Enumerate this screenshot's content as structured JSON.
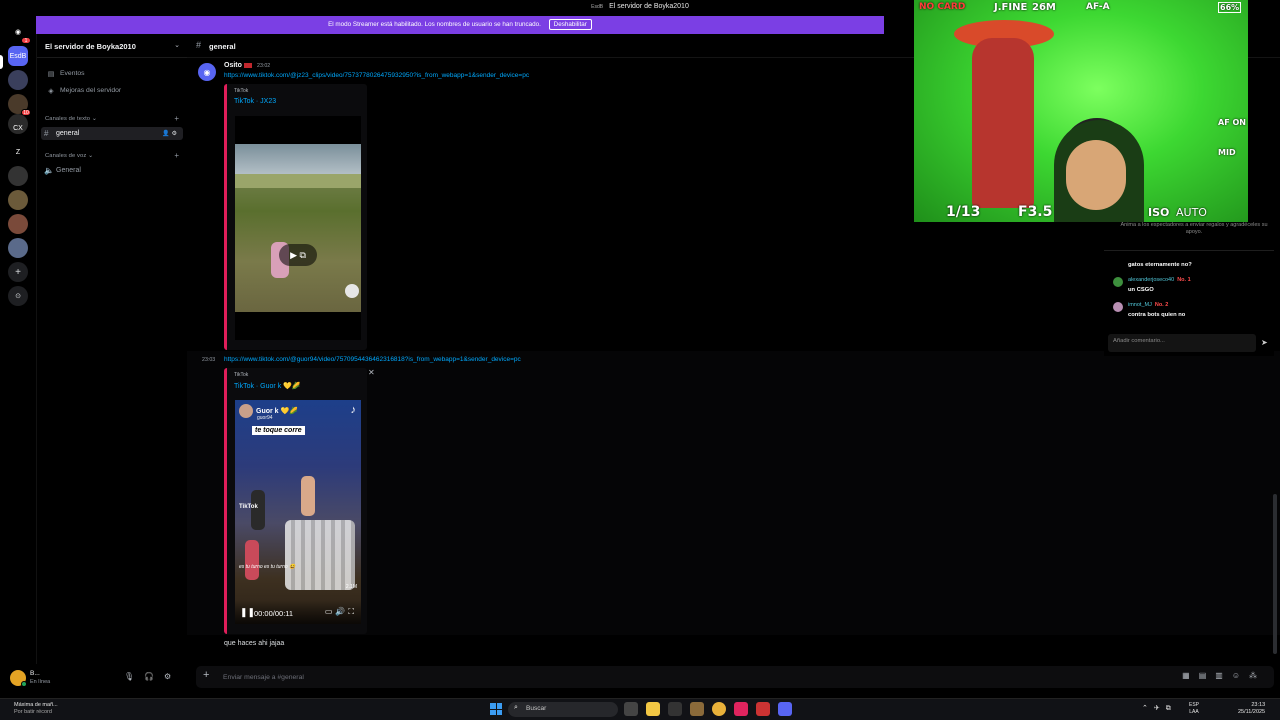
{
  "window": {
    "title": "El servidor de Boyka2010"
  },
  "banner": {
    "text": "El modo Streamer está habilitado. Los nombres de usuario se han truncado.",
    "button": "Deshabilitar"
  },
  "rail": {
    "items": [
      {
        "label": "",
        "icon": "discord-icon",
        "badge": "1"
      },
      {
        "label": "EsdB",
        "icon": "server-icon",
        "badge": ""
      },
      {
        "label": "",
        "icon": "server-icon",
        "badge": ""
      },
      {
        "label": "",
        "icon": "server-icon",
        "badge": "10"
      },
      {
        "label": "",
        "icon": "server-icon",
        "badge": ""
      },
      {
        "label": "CX",
        "icon": "server-icon",
        "badge": ""
      },
      {
        "label": "Z",
        "icon": "server-icon",
        "badge": ""
      },
      {
        "label": "",
        "icon": "server-icon",
        "badge": ""
      },
      {
        "label": "",
        "icon": "server-icon",
        "badge": ""
      },
      {
        "label": "",
        "icon": "server-icon",
        "badge": ""
      },
      {
        "label": "",
        "icon": "server-icon",
        "badge": ""
      },
      {
        "label": "+",
        "icon": "add-server-icon",
        "badge": ""
      },
      {
        "label": "",
        "icon": "compass-icon",
        "badge": ""
      }
    ]
  },
  "sidebar": {
    "server_name": "El servidor de Boyka2010",
    "nav": [
      {
        "label": "Eventos",
        "icon": "calendar-icon"
      },
      {
        "label": "Mejoras del servidor",
        "icon": "boost-icon"
      }
    ],
    "text_category": "Canales de texto",
    "text_channels": [
      {
        "label": "general",
        "active": true
      }
    ],
    "voice_category": "Canales de voz",
    "voice_channels": [
      {
        "label": "General"
      }
    ]
  },
  "user": {
    "name": "B...",
    "status": "En línea"
  },
  "channel": {
    "name": "general"
  },
  "messages": [
    {
      "author": "Osito",
      "time": "23:02",
      "link": "https://www.tiktok.com/@jz23_clips/video/7573778026475932950?is_from_webapp=1&sender_device=pc",
      "embed": {
        "provider": "TikTok",
        "title": "TikTok · JX23"
      }
    },
    {
      "time": "23:03",
      "link": "https://www.tiktok.com/@guor94/video/7570954436462316818?is_from_webapp=1&sender_device=pc",
      "embed": {
        "provider": "TikTok",
        "title": "TikTok · Guor k 💛🌽",
        "video": {
          "creator": "Guor k 💛🌽",
          "handle": "guor94",
          "caption": "te toque corre",
          "watermark": "TikTok",
          "subtitle": "es tu turno es tu turno 😆",
          "time": "00:00/00:11",
          "likes": "2.1M"
        }
      }
    },
    {
      "text": "que haces ahi jajaa"
    }
  ],
  "composer": {
    "placeholder": "Enviar mensaje a #general"
  },
  "camera": {
    "no_card": "NO CARD",
    "focus": "J.FINE",
    "megapixels": "26M",
    "af_mode": "AF-A",
    "battery": "66%",
    "shutter": "1/13",
    "aperture": "F3.5",
    "iso_label": "ISO",
    "iso_value": "AUTO",
    "af_on": "AF ON",
    "metering": "MID"
  },
  "stream_chat": {
    "hint": "Anima a los espectadores a enviar regalos y agradéceles su apoyo.",
    "comments": [
      {
        "user": "",
        "rank": "",
        "text": "gatos eternamente no?",
        "color": "#888888"
      },
      {
        "user": "alexanderjoseco40",
        "rank": "No. 1",
        "text": "un CSGO",
        "color": "#3d8f3d"
      },
      {
        "user": "imnot_MJ",
        "rank": "No. 2",
        "text": "contra bots quien no",
        "color": "#b88fb3"
      }
    ],
    "input_placeholder": "Añadir comentario..."
  },
  "taskbar": {
    "weather_title": "Máxima de mañ...",
    "weather_sub": "Por batir récord",
    "search_placeholder": "Buscar",
    "lang_top": "ESP",
    "lang_bottom": "LAA",
    "time": "23:13",
    "date": "25/11/2025"
  },
  "colors": {
    "accent": "#7b3fe4",
    "link": "#00a8fc",
    "embed_bar": "#e01e5a",
    "online": "#23a55a"
  }
}
